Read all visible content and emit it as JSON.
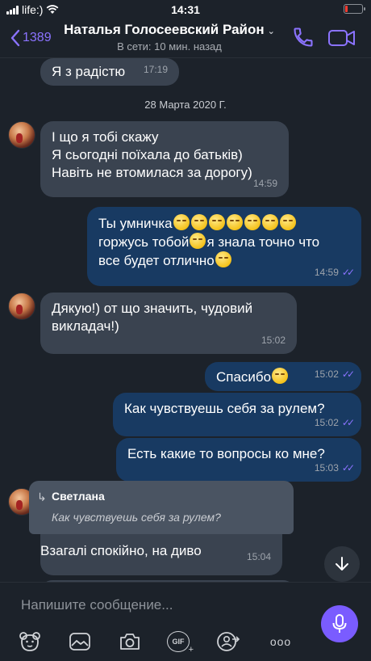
{
  "status_bar": {
    "carrier": "life:)",
    "time": "14:31",
    "battery_level": 0.15,
    "battery_color": "#ff3b30"
  },
  "header": {
    "back_count": "1389",
    "title": "Наталья Голосеевский Район",
    "subtitle": "В сети: 10 мин. назад",
    "accent_color": "#8b73ff",
    "icons": [
      "back-chevron-icon",
      "chevron-down-icon",
      "phone-icon",
      "video-camera-icon"
    ]
  },
  "chat": {
    "date_separator": "28 Марта 2020 Г.",
    "messages": [
      {
        "direction": "in",
        "text": "Я з радістю",
        "time": "17:19"
      },
      {
        "direction": "in",
        "lines": [
          "І що я тобі скажу",
          "Я сьогодні поїхала до батьків)",
          "Навіть не втомилася за дорогу)"
        ],
        "time": "14:59"
      },
      {
        "direction": "out",
        "lines": [
          "Ты умничка",
          "горжусь тобой",
          "я знала точно что",
          "все будет отлично"
        ],
        "time": "14:59"
      },
      {
        "direction": "in",
        "lines": [
          "Дякую!) от що значить, чудовий",
          "викладач!)"
        ],
        "time": "15:02"
      },
      {
        "direction": "out",
        "text": "Спасибо",
        "time": "15:02"
      },
      {
        "direction": "out",
        "text": "Как чувствуешь себя за рулем?",
        "time": "15:02"
      },
      {
        "direction": "out",
        "text": "Есть какие то вопросы ко мне?",
        "time": "15:03"
      },
      {
        "direction": "in",
        "reply_name": "Светлана",
        "reply_text": "Как чувствуешь себя за рулем?",
        "text": "Взагалі спокійно, на диво",
        "time": "15:04"
      }
    ],
    "bubble_in_color": "#3a4350",
    "bubble_out_color": "#183a62"
  },
  "composer": {
    "placeholder": "Напишите сообщение...",
    "toolbar_icons": [
      "sticker-bear-icon",
      "gallery-icon",
      "camera-icon",
      "gif-icon",
      "share-contact-icon",
      "more-icon"
    ],
    "gif_label": "GIF",
    "more_label": "ooo",
    "mic_color": "#7a5cff"
  }
}
